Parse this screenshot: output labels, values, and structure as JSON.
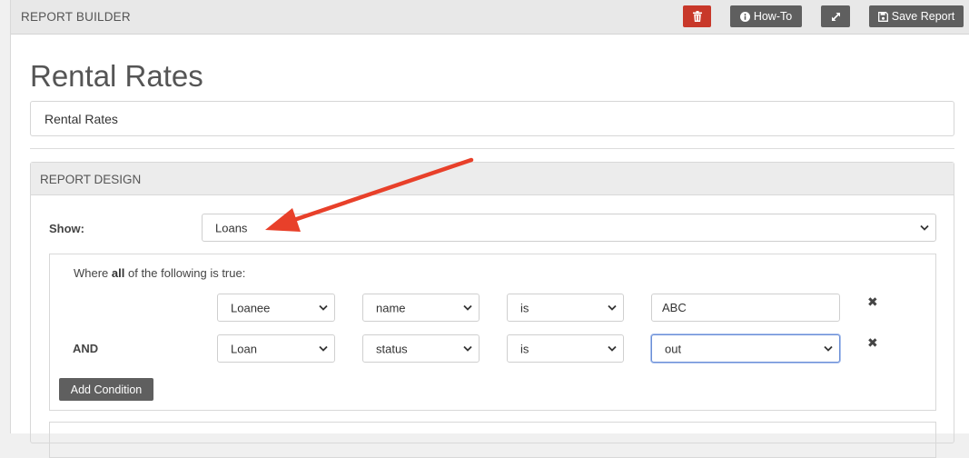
{
  "header": {
    "title": "REPORT BUILDER",
    "delete_icon": "trash-icon",
    "howto_label": "How-To",
    "howto_icon": "info-circle-icon",
    "expand_icon": "expand-arrows-icon",
    "save_label": "Save Report",
    "save_icon": "floppy-disk-icon"
  },
  "report": {
    "title": "Rental Rates",
    "name_value": "Rental Rates"
  },
  "design": {
    "section_title": "REPORT DESIGN",
    "show_label": "Show:",
    "show_value": "Loans",
    "conditions_intro_prefix": "Where ",
    "conditions_intro_bold": "all",
    "conditions_intro_suffix": " of the following is true:",
    "conditions": [
      {
        "connector": "",
        "entity": "Loanee",
        "field": "name",
        "operator": "is",
        "value": "ABC"
      },
      {
        "connector": "AND",
        "entity": "Loan",
        "field": "status",
        "operator": "is",
        "value": "out"
      }
    ],
    "remove_icon": "close-x-icon",
    "add_condition_label": "Add Condition"
  },
  "colors": {
    "accent_red": "#c8382a",
    "button_gray": "#5f5f5f",
    "annotation_arrow": "#e8402a"
  }
}
